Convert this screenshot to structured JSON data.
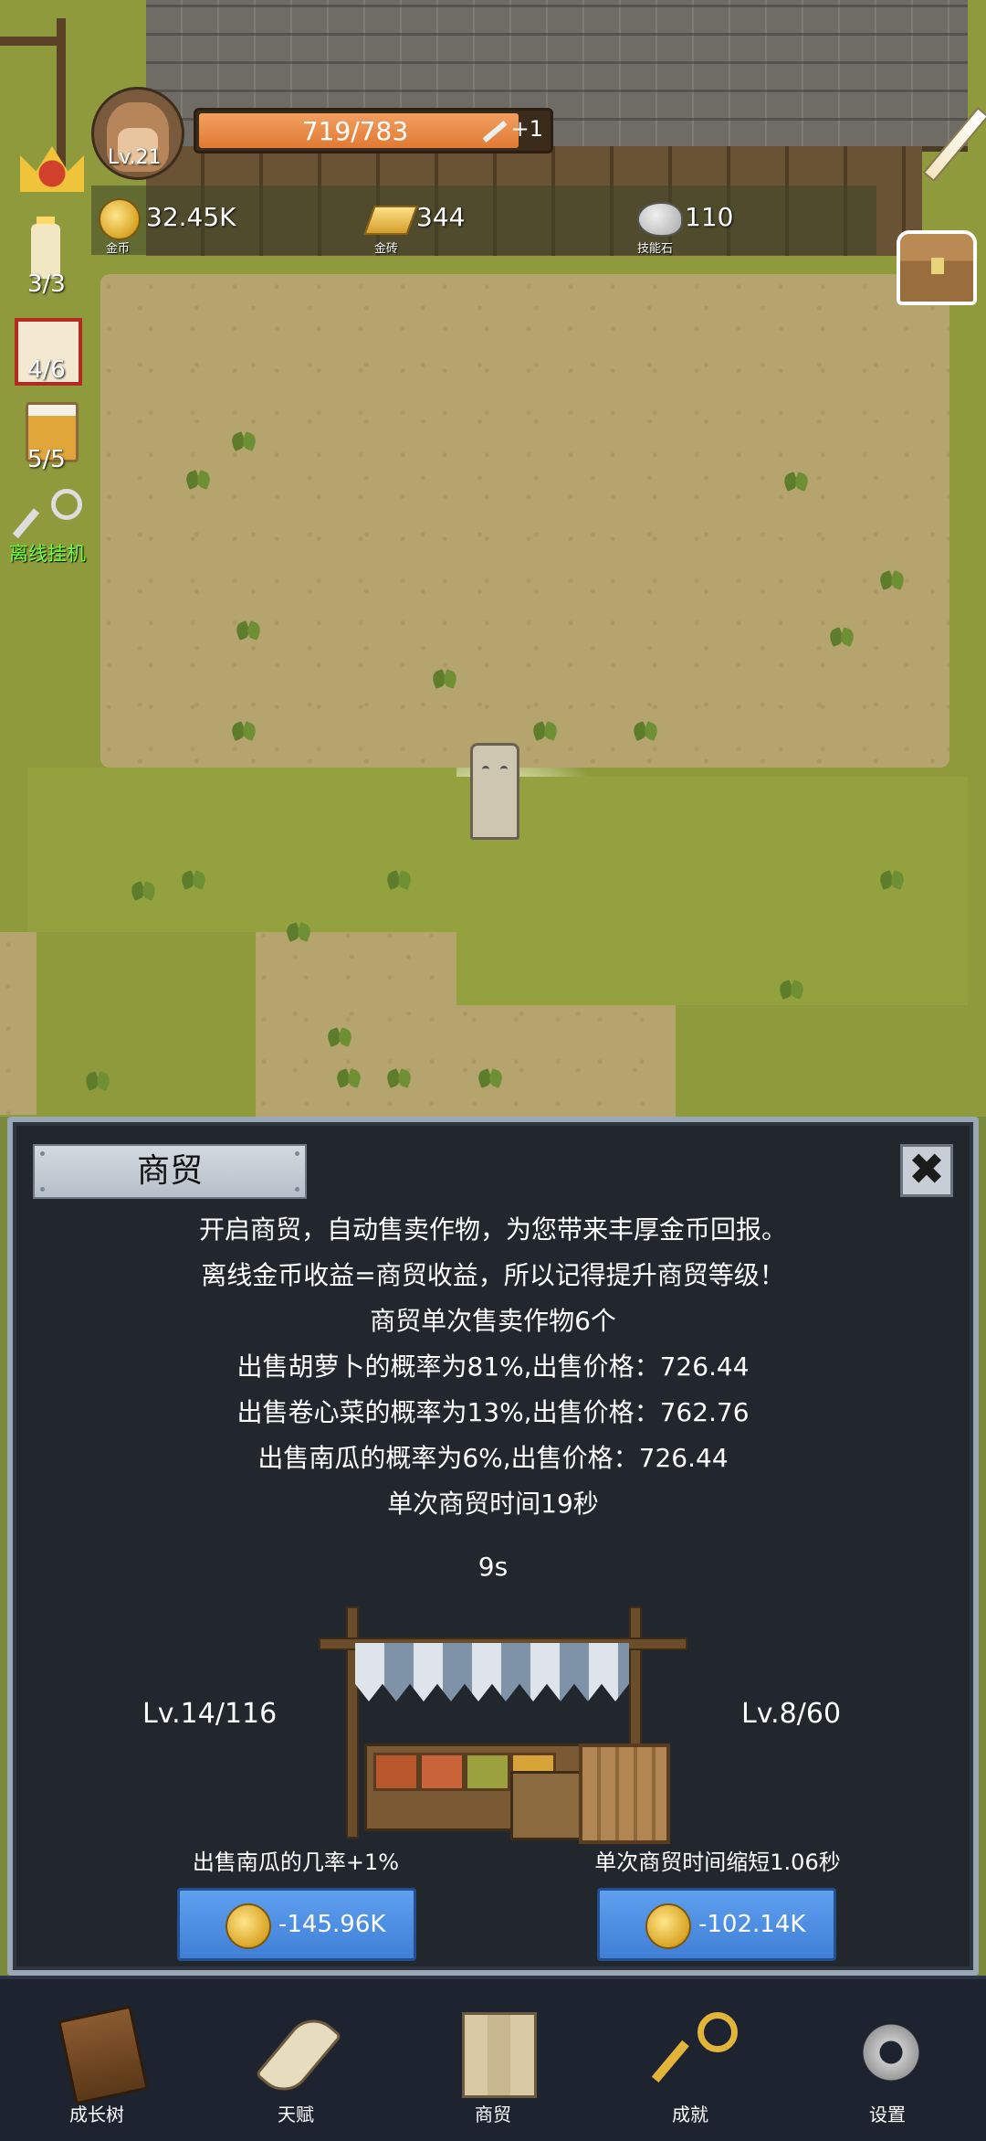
{
  "hud": {
    "level": "Lv.21",
    "xp": {
      "text": "719/783",
      "current": 719,
      "max": 783
    },
    "xp_bonus": "+1",
    "resources": [
      {
        "icon": "gold-coin-icon",
        "value": "32.45K",
        "label": "金币"
      },
      {
        "icon": "gold-brick-icon",
        "value": "344",
        "label": "金砖"
      },
      {
        "icon": "skill-stone-icon",
        "value": "110",
        "label": "技能石"
      }
    ],
    "side": {
      "candle": "3/3",
      "dice": "4/6",
      "beer": "5/5",
      "idle_label": "离线挂机"
    }
  },
  "trade": {
    "title": "商贸",
    "close_label": "✖",
    "description": [
      "开启商贸，自动售卖作物，为您带来丰厚金币回报。",
      "离线金币收益=商贸收益，所以记得提升商贸等级！",
      "商贸单次售卖作物6个",
      "出售胡萝卜的概率为81%,出售价格：726.44",
      "出售卷心菜的概率为13%,出售价格：762.76",
      "出售南瓜的概率为6%,出售价格：726.44",
      "单次商贸时间19秒"
    ],
    "timer": "9s",
    "left_upgrade": {
      "level": "Lv.14/116",
      "label": "出售南瓜的几率+1%",
      "cost": "-145.96K"
    },
    "right_upgrade": {
      "level": "Lv.8/60",
      "label": "单次商贸时间缩短1.06秒",
      "cost": "-102.14K"
    }
  },
  "nav": {
    "items": [
      {
        "label": "成长树",
        "icon": "book-icon"
      },
      {
        "label": "天赋",
        "icon": "scroll-icon"
      },
      {
        "label": "商贸",
        "icon": "map-icon"
      },
      {
        "label": "成就",
        "icon": "key-icon"
      },
      {
        "label": "设置",
        "icon": "gear-icon"
      }
    ]
  },
  "colors": {
    "panel_bg": "#22272e",
    "button_blue": "#3f7fd6",
    "xp_orange": "#e07a34",
    "idle_green": "#6dff3a"
  }
}
